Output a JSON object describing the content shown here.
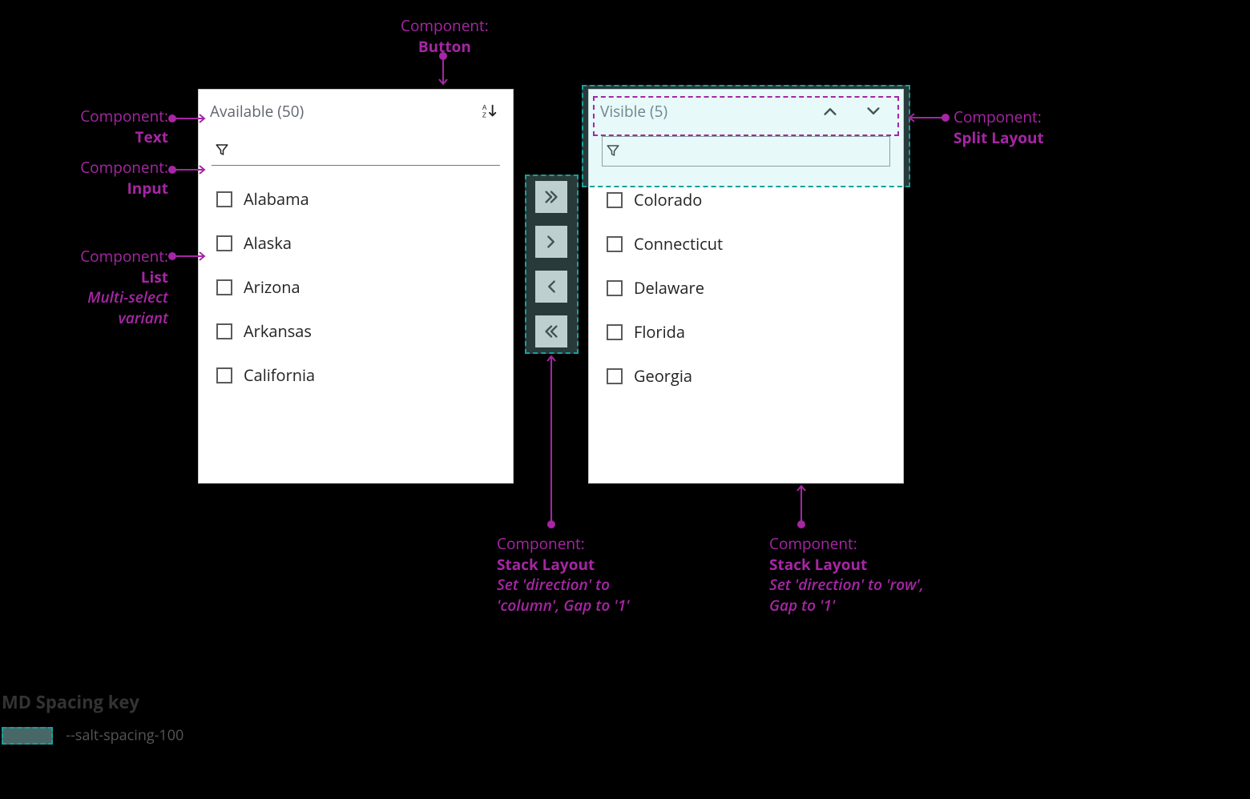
{
  "callouts": {
    "button": {
      "ln1": "Component:",
      "ln2": "Button"
    },
    "text": {
      "ln1": "Component:",
      "ln2": "Text"
    },
    "input": {
      "ln1": "Component:",
      "ln2": "Input"
    },
    "list": {
      "ln1": "Component:",
      "ln2": "List",
      "ln3": "Multi-select variant"
    },
    "splitlayout": {
      "ln1": "Component:",
      "ln2": "Split Layout"
    },
    "stack_col": {
      "ln1": "Component:",
      "ln2": "Stack Layout",
      "ln3": "Set 'direction' to 'column', Gap to '1'"
    },
    "stack_row": {
      "ln1": "Component:",
      "ln2": "Stack Layout",
      "ln3": "Set 'direction' to 'row', Gap to '1'"
    }
  },
  "panels": {
    "available": {
      "title": "Available (50)",
      "items": [
        "Alabama",
        "Alaska",
        "Arizona",
        "Arkansas",
        "California"
      ]
    },
    "visible": {
      "title": "Visible (5)",
      "items": [
        "Colorado",
        "Connecticut",
        "Delaware",
        "Florida",
        "Georgia"
      ]
    }
  },
  "spacing_key": {
    "heading": "MD Spacing key",
    "token": "--salt-spacing-100"
  },
  "colors": {
    "callout": "#a626a4",
    "teal": "#1a9e9e"
  }
}
